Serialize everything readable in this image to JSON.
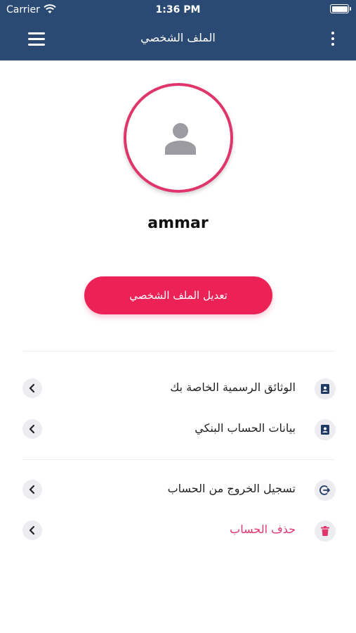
{
  "status_bar": {
    "carrier": "Carrier",
    "time": "1:36 PM"
  },
  "header": {
    "title": "الملف الشخصي"
  },
  "profile": {
    "username": "ammar",
    "edit_button": "تعديل الملف الشخصي"
  },
  "menu": {
    "documents": "الوثائق الرسمية الخاصة بك",
    "bank": "بيانات الحساب البنكي",
    "logout": "تسجيل الخروج من الحساب",
    "delete": "حذف الحساب"
  },
  "colors": {
    "header": "#2b4a73",
    "accent": "#ec2256",
    "danger": "#e0356a"
  }
}
